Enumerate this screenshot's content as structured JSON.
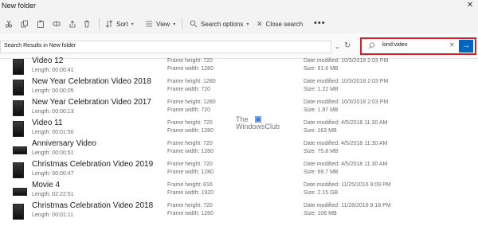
{
  "window": {
    "title": "New folder"
  },
  "toolbar": {
    "sort_label": "Sort",
    "view_label": "View",
    "search_options_label": "Search options",
    "close_search_label": "Close search",
    "more_label": "•••"
  },
  "address": {
    "text": "Search Results in New folder"
  },
  "search": {
    "value": "kind:video"
  },
  "watermark": {
    "line1": "The",
    "line2": "WindowsClub"
  },
  "colors": {
    "accent": "#0067c0",
    "highlight": "#d3202a"
  },
  "files": [
    {
      "name": "Video 12",
      "length": "Length: 00:00:41",
      "frame_height": "Frame height: 720",
      "frame_width": "Frame width: 1280",
      "date_modified": "Date modified: 10/3/2018 2:03 PM",
      "size": "Size: 61.6 MB"
    },
    {
      "name": "New Year Celebration Video 2018",
      "length": "Length: 00:00:05",
      "frame_height": "Frame height: 1280",
      "frame_width": "Frame width: 720",
      "date_modified": "Date modified: 10/3/2018 2:03 PM",
      "size": "Size: 1.22 MB"
    },
    {
      "name": "New Year Celebration Video 2017",
      "length": "Length: 00:00:13",
      "frame_height": "Frame height: 1280",
      "frame_width": "Frame width: 720",
      "date_modified": "Date modified: 10/3/2018 2:03 PM",
      "size": "Size: 1.97 MB"
    },
    {
      "name": "Video 11",
      "length": "Length: 00:01:50",
      "frame_height": "Frame height: 720",
      "frame_width": "Frame width: 1280",
      "date_modified": "Date modified: 4/5/2018 11:30 AM",
      "size": "Size: 163 MB"
    },
    {
      "name": "Anniversary Video",
      "length": "Length: 00:00:51",
      "frame_height": "Frame height: 720",
      "frame_width": "Frame width: 1280",
      "date_modified": "Date modified: 4/5/2018 11:30 AM",
      "size": "Size: 75.8 MB"
    },
    {
      "name": "Christmas Celebration Video 2019",
      "length": "Length: 00:00:47",
      "frame_height": "Frame height: 720",
      "frame_width": "Frame width: 1280",
      "date_modified": "Date modified: 4/5/2018 11:30 AM",
      "size": "Size: 69.7 MB"
    },
    {
      "name": "Movie 4",
      "length": "Length: 02:22:51",
      "frame_height": "Frame height: 816",
      "frame_width": "Frame width: 1920",
      "date_modified": "Date modified: 11/25/2016 9:09 PM",
      "size": "Size: 2.15 GB"
    },
    {
      "name": "Christmas Celebration Video 2018",
      "length": "Length: 00:01:11",
      "frame_height": "Frame height: 720",
      "frame_width": "Frame width: 1280",
      "date_modified": "Date modified: 11/28/2016 9:18 PM",
      "size": "Size: 106 MB"
    }
  ]
}
